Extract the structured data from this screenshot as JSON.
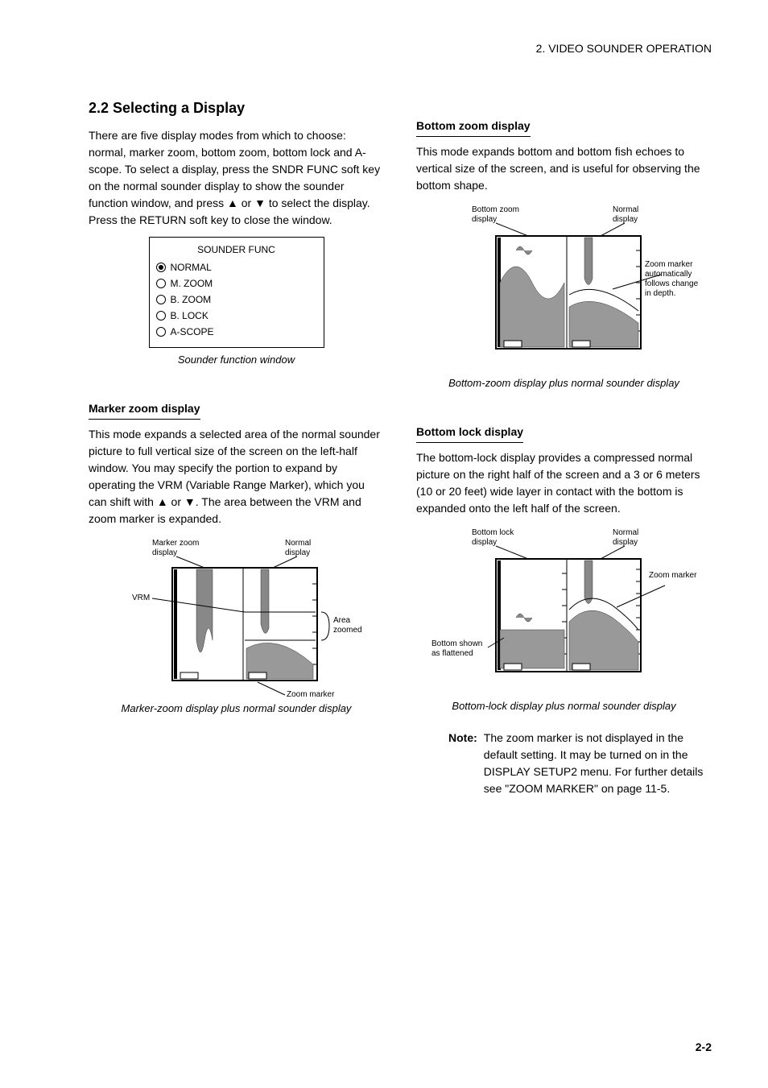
{
  "header": "2. VIDEO SOUNDER OPERATION",
  "left": {
    "title": "2.2 Selecting a Display",
    "intro": "There are five display modes from which to choose: normal, marker zoom, bottom zoom, bottom lock and A-scope. To select a display, press the SNDR FUNC soft key on the normal sounder display to show the sounder function window, and press ▲ or ▼ to select the display. Press the RETURN soft key to close the window.",
    "func": {
      "title": "SOUNDER FUNC",
      "items": [
        "NORMAL",
        "M. ZOOM",
        "B. ZOOM",
        "B. LOCK",
        "A-SCOPE"
      ]
    },
    "caption1": "Sounder function window",
    "mz_heading": "Marker zoom display",
    "mz_text": "This mode expands a selected area of the normal sounder picture to full vertical size of the screen on the left-half window. You may specify the portion to expand by operating the VRM (Variable Range Marker), which you can shift with ▲ or ▼. The area between the VRM and zoom marker is expanded.",
    "mz_diag": {
      "mz_disp": "Marker zoom\ndisplay",
      "normal_disp": "Normal\ndisplay",
      "vrm": "VRM",
      "area": "Area\nzoomed",
      "zm": "Zoom marker"
    },
    "caption2": "Marker-zoom display plus normal sounder display"
  },
  "right": {
    "bz_heading": "Bottom zoom display",
    "bz_text": "This mode expands bottom and bottom fish echoes to vertical size of the screen, and is useful for observing the bottom shape.",
    "bz_diag": {
      "bz_disp": "Bottom zoom\ndisplay",
      "normal_disp": "Normal\ndisplay",
      "zm_auto": "Zoom marker\nautomatically\nfollows change\nin depth."
    },
    "caption_bz": "Bottom-zoom display plus normal sounder display",
    "bl_heading": "Bottom lock display",
    "bl_text": "The bottom-lock display provides a compressed normal picture on the right half of the screen and a 3 or 6 meters (10 or 20 feet) wide layer in contact with the bottom is expanded onto the left half of the screen.",
    "bl_diag": {
      "bl_disp": "Bottom lock\ndisplay",
      "normal_disp": "Normal\ndisplay",
      "flat": "Bottom shown\nas flattened",
      "zm": "Zoom marker"
    },
    "caption_bl": "Bottom-lock display plus normal sounder display",
    "note_label": "Note:",
    "note_text": "The zoom marker is not displayed in the default setting. It may be turned on in the DISPLAY SETUP2 menu. For further details see \"ZOOM MARKER\" on page 11-5."
  },
  "page_num": "2-2"
}
